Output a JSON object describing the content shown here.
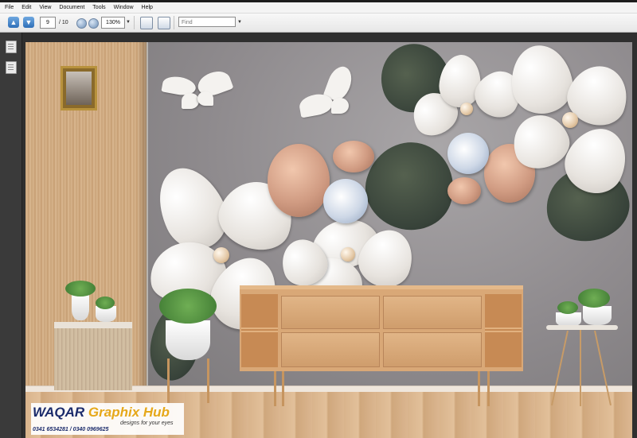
{
  "menu": {
    "items": [
      "File",
      "Edit",
      "View",
      "Document",
      "Tools",
      "Window",
      "Help"
    ]
  },
  "toolbar": {
    "current_page": "9",
    "page_total": "/ 10",
    "zoom": "130%",
    "find_placeholder": "Find"
  },
  "icons": {
    "prev_page": "arrow-up-icon",
    "next_page": "arrow-down-icon",
    "zoom_out": "zoom-out-icon",
    "zoom_in": "zoom-in-icon",
    "save": "save-icon",
    "fit": "fit-page-icon",
    "pages_panel": "pages-panel-icon",
    "attachments_panel": "attachments-panel-icon"
  },
  "watermark": {
    "brand": "WAQAR",
    "brand_suffix": "Graphix Hub",
    "tagline": "designs for your eyes",
    "phones": "0341 6534281 / 0340 0969625"
  },
  "colors": {
    "brand_blue": "#1b2b6b",
    "brand_gold": "#e6a81a"
  }
}
